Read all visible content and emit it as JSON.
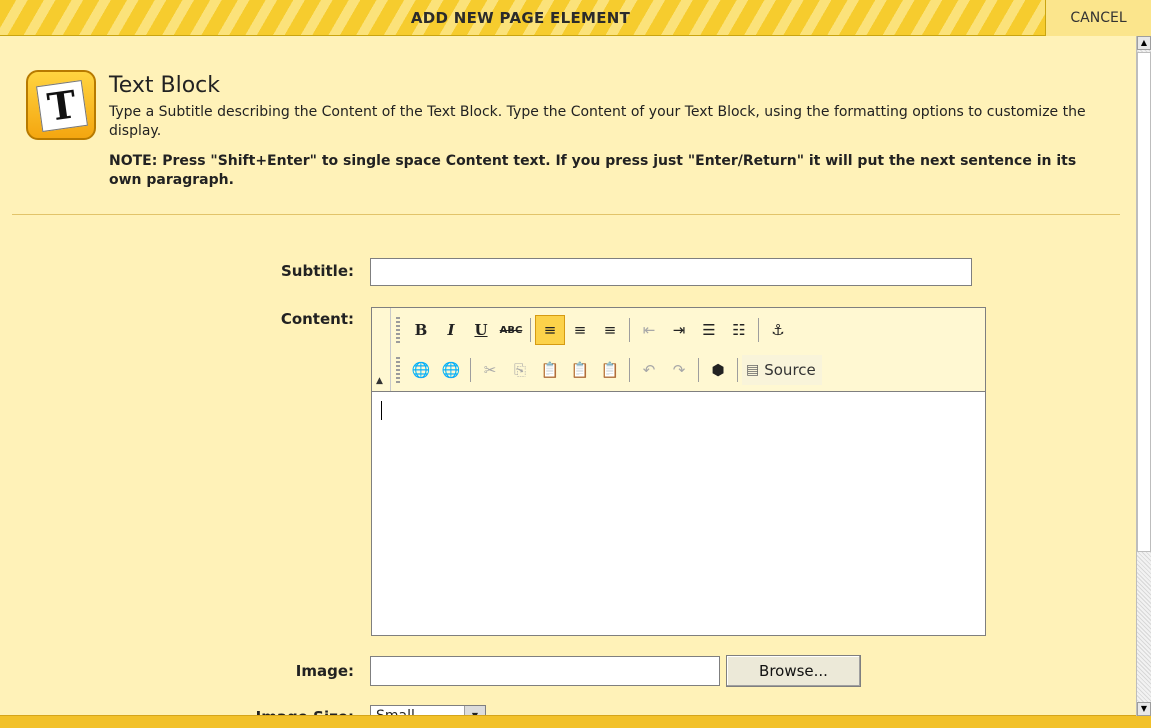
{
  "header": {
    "title": "ADD NEW PAGE ELEMENT",
    "cancel_label": "CANCEL"
  },
  "intro": {
    "icon_letter": "T",
    "title": "Text Block",
    "description": "Type a Subtitle describing the Content of the Text Block. Type the Content of your Text Block, using the formatting options to customize the display.",
    "note": "NOTE: Press \"Shift+Enter\" to single space Content text. If you press just \"Enter/Return\" it will put the next sentence in its own paragraph."
  },
  "form": {
    "subtitle_label": "Subtitle:",
    "subtitle_value": "",
    "content_label": "Content:",
    "image_label": "Image:",
    "image_value": "",
    "browse_label": "Browse...",
    "image_size_label": "Image Size:",
    "image_size_value": "Small"
  },
  "toolbar": {
    "bold": "B",
    "italic": "I",
    "underline": "U",
    "strike": "ABC",
    "align_left": "≡",
    "align_center": "≡",
    "align_right": "≡",
    "outdent": "⇤",
    "indent": "⇥",
    "ordered_list": "☰",
    "unordered_list": "☷",
    "anchor": "⚓",
    "link": "🌐",
    "unlink": "🌐",
    "cut": "✂",
    "copy": "⎘",
    "paste": "📋",
    "paste_text": "📋",
    "paste_word": "📋",
    "undo": "↶",
    "redo": "↷",
    "insert_object": "⬢",
    "source_icon": "▤",
    "source_label": "Source"
  },
  "colors": {
    "page_background": "#fff2b8",
    "header_stripe_dark": "#f6cc2e",
    "header_stripe_light": "#fbe27a",
    "active_button": "#fcd24a"
  }
}
